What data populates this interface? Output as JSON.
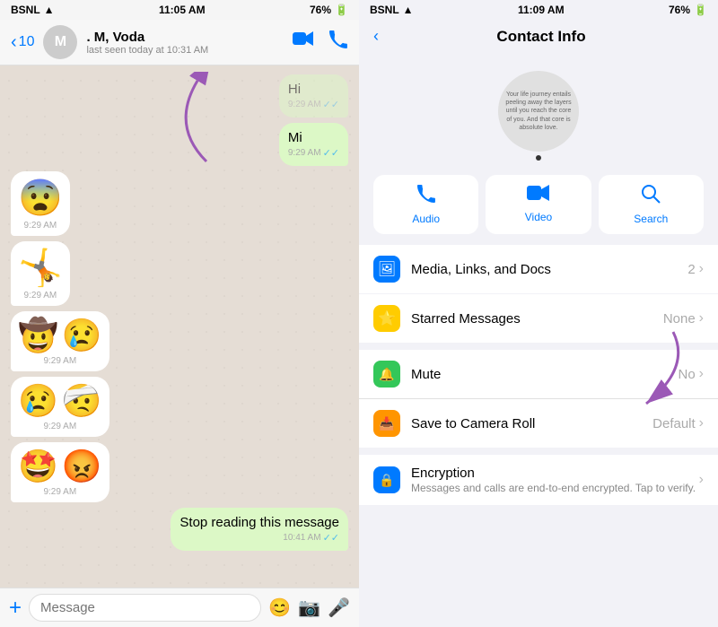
{
  "left": {
    "status": {
      "carrier": "BSNL",
      "time": "11:05 AM",
      "battery": "76%"
    },
    "header": {
      "back_label": "10",
      "contact_name": ". M, Voda",
      "last_seen": "last seen today at 10:31 AM",
      "video_icon": "📹",
      "phone_icon": "📞"
    },
    "messages": [
      {
        "type": "sent_text",
        "text": "Hi",
        "time": "9:29 AM",
        "ticks": "✓✓"
      },
      {
        "type": "sent_mi",
        "text": "Mi",
        "time": "9:29 AM",
        "ticks": "✓✓"
      },
      {
        "type": "received_emoji",
        "emojis": [
          "😨"
        ],
        "time": "9:29 AM"
      },
      {
        "type": "received_emoji",
        "emojis": [
          "🤸"
        ],
        "time": "9:29 AM"
      },
      {
        "type": "received_emoji_double",
        "emojis": [
          "🤠",
          "😢"
        ],
        "time": "9:29 AM"
      },
      {
        "type": "received_emoji_double",
        "emojis": [
          "😢",
          "🤕"
        ],
        "time": "9:29 AM"
      },
      {
        "type": "received_emoji_double",
        "emojis": [
          "🤩",
          "😡"
        ],
        "time": "9:29 AM"
      },
      {
        "type": "sent_bubble",
        "text": "Stop reading this message",
        "time": "10:41 AM",
        "ticks": "✓✓"
      }
    ],
    "input": {
      "placeholder": "Message"
    }
  },
  "right": {
    "status": {
      "carrier": "BSNL",
      "time": "11:09 AM",
      "battery": "76%"
    },
    "header": {
      "title": "Contact Info"
    },
    "profile": {
      "quote": "Your life journey entails peeling away the layers until you reach the core of you. And that core is absolute love."
    },
    "actions": [
      {
        "id": "audio",
        "icon": "📞",
        "label": "Audio"
      },
      {
        "id": "video",
        "icon": "📹",
        "label": "Video"
      },
      {
        "id": "search",
        "icon": "🔍",
        "label": "Search"
      }
    ],
    "info_rows": [
      {
        "id": "media",
        "icon": "🖼",
        "icon_class": "icon-blue",
        "title": "Media, Links, and Docs",
        "value": "2",
        "chevron": ">"
      },
      {
        "id": "starred",
        "icon": "⭐",
        "icon_class": "icon-yellow",
        "title": "Starred Messages",
        "value": "None",
        "chevron": ">"
      },
      {
        "id": "mute",
        "icon": "🔔",
        "icon_class": "icon-green",
        "title": "Mute",
        "value": "No",
        "chevron": ">"
      },
      {
        "id": "save_camera",
        "icon": "📥",
        "icon_class": "icon-orange",
        "title": "Save to Camera Roll",
        "value": "Default",
        "chevron": ">"
      },
      {
        "id": "encryption",
        "icon": "🔒",
        "icon_class": "icon-blue2",
        "title": "Encryption",
        "subtitle": "Messages and calls are end-to-end encrypted. Tap to verify.",
        "value": "",
        "chevron": ">"
      }
    ]
  }
}
